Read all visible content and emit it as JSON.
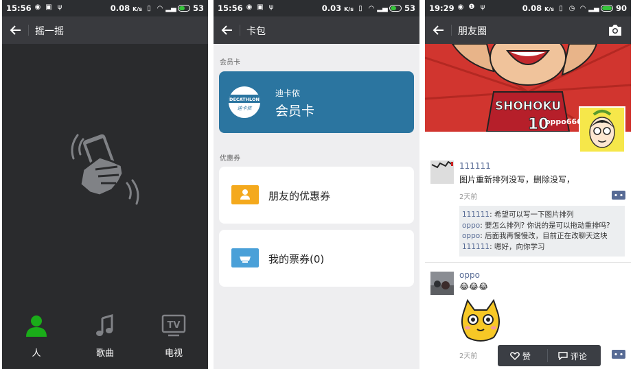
{
  "screens": [
    {
      "status": {
        "time": "15:56",
        "net_speed": "0.08",
        "net_unit": "K/s",
        "battery": "53",
        "battery_level": 0.53
      },
      "title": "摇一摇",
      "tabs": [
        {
          "label": "人",
          "icon": "person-icon",
          "active": true
        },
        {
          "label": "歌曲",
          "icon": "music-note-icon",
          "active": false
        },
        {
          "label": "电视",
          "icon": "tv-icon",
          "active": false
        }
      ]
    },
    {
      "status": {
        "time": "15:56",
        "net_speed": "0.03",
        "net_unit": "K/s",
        "battery": "53",
        "battery_level": 0.53
      },
      "title": "卡包",
      "member_section": "会员卡",
      "member_card": {
        "brand": "迪卡侬",
        "name": "会员卡",
        "logo_text": "DECATHLON",
        "logo_sub": "迪卡侬",
        "color": "#2b75a0"
      },
      "coupon_section": "优惠券",
      "coupons": [
        {
          "label": "朋友的优惠券",
          "icon": "friend-coupon-icon",
          "color": "#f4a91d"
        },
        {
          "label": "我的票券(0)",
          "icon": "ticket-icon",
          "color": "#4aa0d8"
        }
      ]
    },
    {
      "status": {
        "time": "19:29",
        "net_speed": "0.08",
        "net_unit": "K/s",
        "battery": "90",
        "battery_level": 0.9
      },
      "title": "朋友圈",
      "cover": {
        "jersey_text": "SHOHOKU",
        "jersey_number": "10"
      },
      "profile_name": "oppo666",
      "posts": [
        {
          "user": "111111",
          "text": "图片重新排列没写，删除没写，",
          "time": "2天前",
          "comments": [
            {
              "user": "111111",
              "text": "希望可以写一下图片排列"
            },
            {
              "user": "oppo",
              "text": "要怎么排列? 你说的是可以拖动重排吗?"
            },
            {
              "user": "oppo",
              "text": "后面我再慢慢改，目前正在改聊天这块"
            },
            {
              "user": "111111",
              "text": "嗯好，向你学习"
            }
          ]
        },
        {
          "user": "oppo",
          "text": "😂😂😂",
          "time": "2天前"
        }
      ],
      "actions": {
        "like": "赞",
        "comment": "评论"
      }
    }
  ],
  "colors": {
    "accent_green": "#1aad19",
    "link_blue": "#576b95",
    "dark_bar": "#393a3e"
  }
}
